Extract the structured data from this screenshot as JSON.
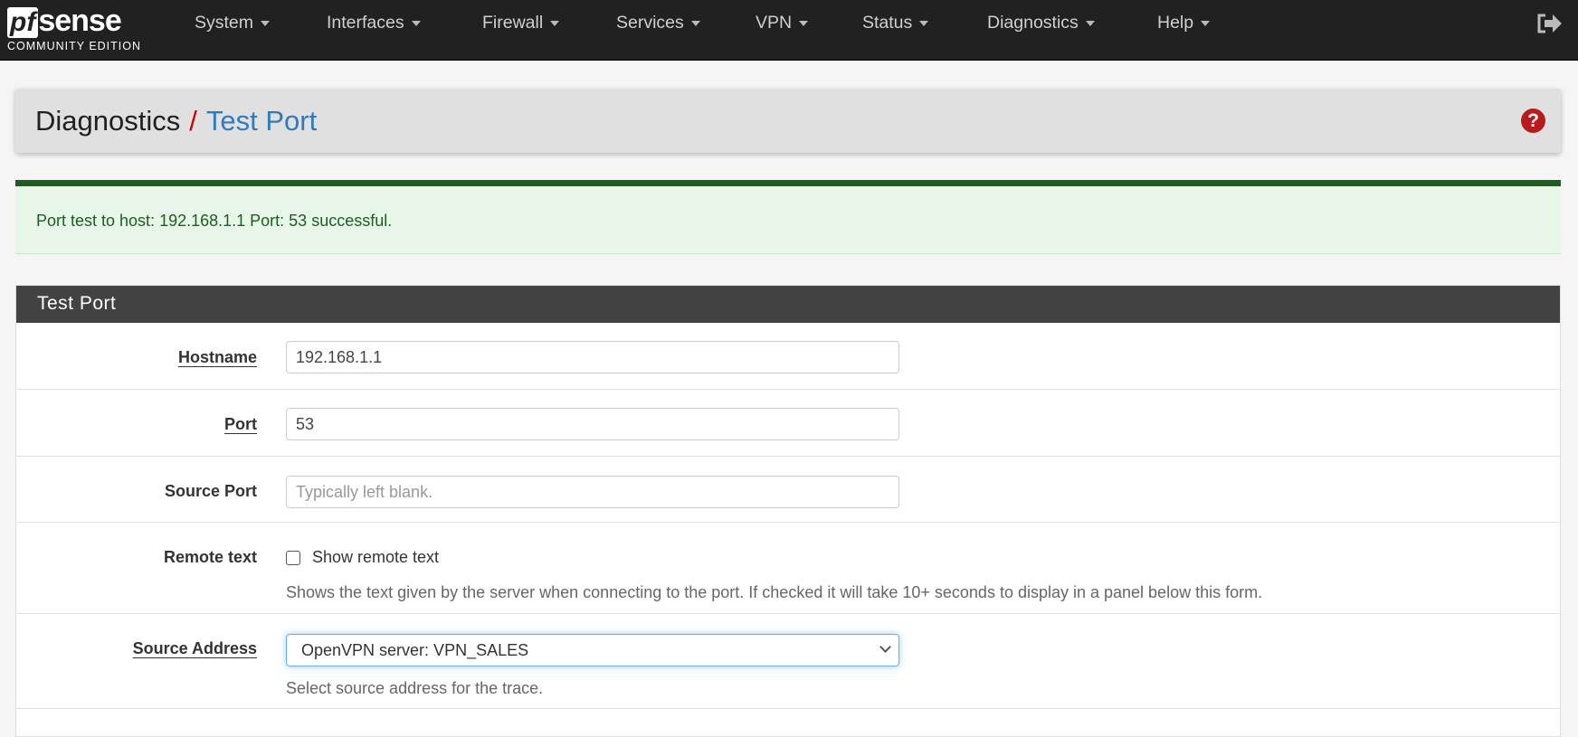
{
  "nav": {
    "logo": {
      "pf": "pf",
      "sense": "sense",
      "edition": "COMMUNITY EDITION"
    },
    "items": [
      "System",
      "Interfaces",
      "Firewall",
      "Services",
      "VPN",
      "Status",
      "Diagnostics",
      "Help"
    ]
  },
  "header": {
    "section": "Diagnostics",
    "separator": "/",
    "page": "Test Port"
  },
  "alert": {
    "message": "Port test to host: 192.168.1.1 Port: 53 successful.",
    "color": "#1b5e20"
  },
  "panel": {
    "title": "Test Port",
    "hostname": {
      "label": "Hostname",
      "value": "192.168.1.1"
    },
    "port": {
      "label": "Port",
      "value": "53"
    },
    "source_port": {
      "label": "Source Port",
      "value": "",
      "placeholder": "Typically left blank."
    },
    "remote_text": {
      "label": "Remote text",
      "checkbox_label": "Show remote text",
      "checked": false,
      "help": "Shows the text given by the server when connecting to the port. If checked it will take 10+ seconds to display in a panel below this form."
    },
    "source_address": {
      "label": "Source Address",
      "selected": "OpenVPN server: VPN_SALES",
      "help": "Select source address for the trace."
    }
  }
}
